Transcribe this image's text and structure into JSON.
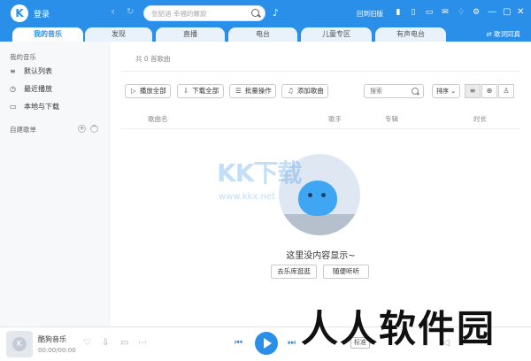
{
  "topbar": {
    "logo_letter": "K",
    "login_label": "登录",
    "search_placeholder": "张韶涵 幸福的螺旋",
    "old_version_label": "回到旧版",
    "mic_icon": "mic-icon"
  },
  "tabs": [
    {
      "label": "我的音乐",
      "active": true
    },
    {
      "label": "发现",
      "active": false
    },
    {
      "label": "直播",
      "active": false
    },
    {
      "label": "电台",
      "active": false
    },
    {
      "label": "儿童专区",
      "active": false
    },
    {
      "label": "有声电台",
      "active": false
    }
  ],
  "sync_label": "歌词同真",
  "sidebar": {
    "section_title": "我的音乐",
    "items": [
      {
        "label": "默认列表",
        "icon": "list-icon"
      },
      {
        "label": "最近播放",
        "icon": "clock-icon"
      },
      {
        "label": "本地与下载",
        "icon": "monitor-icon"
      }
    ],
    "custom_title": "自建歌单"
  },
  "main": {
    "count_text": "共 0 首歌曲",
    "buttons": {
      "play_all": "播放全部",
      "download_all": "下载全部",
      "batch": "批量操作",
      "add_song": "添加歌曲"
    },
    "search_placeholder": "搜索",
    "sort_label": "排序",
    "columns": {
      "song": "歌曲名",
      "singer": "歌手",
      "album": "专辑",
      "duration": "时长"
    },
    "empty_text": "这里没内容显示~",
    "empty_buttons": {
      "library": "去乐库逛逛",
      "random": "随便听听"
    },
    "watermark_big": "KK下载",
    "watermark_url": "www.kkx.net"
  },
  "player": {
    "song_name": "酷狗音乐",
    "time": "00:00/00:00",
    "quality": "标准"
  },
  "corner_watermark": "人人软件园",
  "colors": {
    "brand": "#2a8fe8",
    "sidebar_bg": "#f7f8fa"
  }
}
